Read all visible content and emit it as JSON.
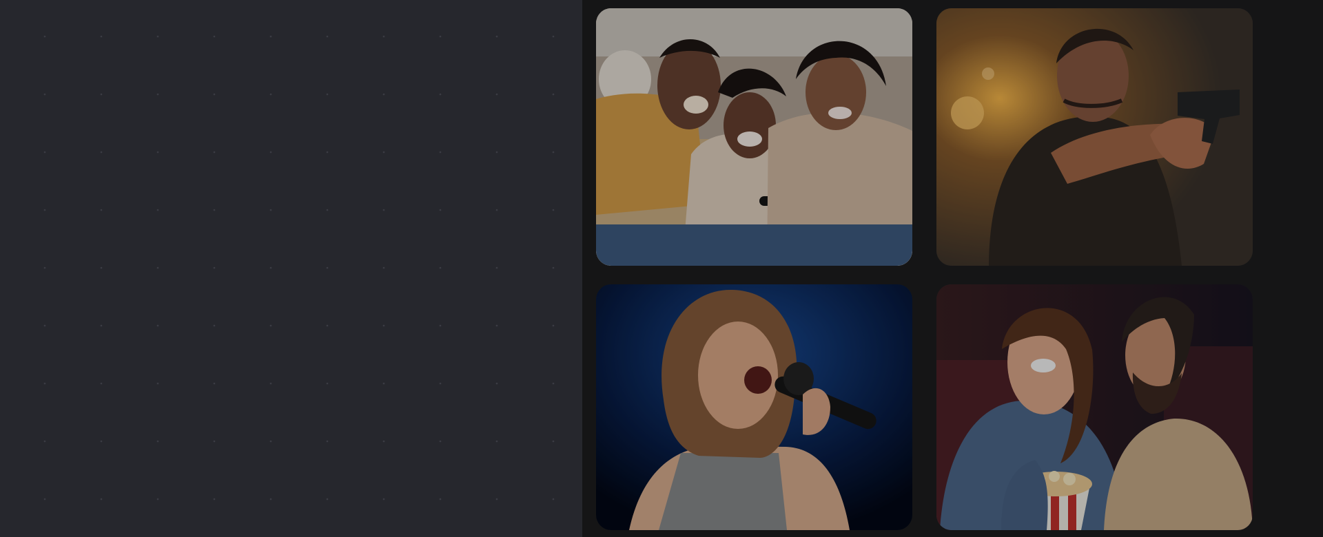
{
  "left_panel": {
    "background_color": "#26272d",
    "pattern": "dot-grid"
  },
  "gallery": {
    "tiles": [
      {
        "icon": "family-watching-tv-photo"
      },
      {
        "icon": "action-movie-gunman-photo"
      },
      {
        "icon": "karaoke-singer-photo"
      },
      {
        "icon": "cinema-couple-popcorn-photo"
      }
    ]
  },
  "colors": {
    "page_background": "#121214",
    "left_panel": "#26272d",
    "right_panel": "#151516",
    "popcorn_red": "#c8332f"
  }
}
